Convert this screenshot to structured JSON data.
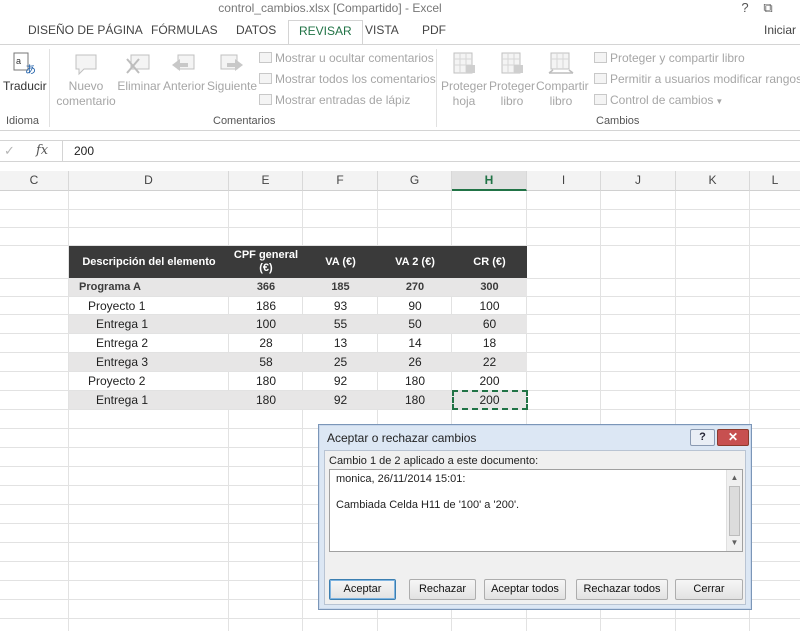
{
  "window": {
    "title": "control_cambios.xlsx  [Compartido] - Excel",
    "help_btn": "?",
    "restore_btn": "⧉"
  },
  "tabs": [
    {
      "label": "DISEÑO DE PÁGINA"
    },
    {
      "label": "FÓRMULAS"
    },
    {
      "label": "DATOS"
    },
    {
      "label": "REVISAR"
    },
    {
      "label": "VISTA"
    },
    {
      "label": "PDF"
    }
  ],
  "signin": "Iniciar",
  "ribbon": {
    "idioma": {
      "translate": "Traducir",
      "group": "Idioma"
    },
    "comentarios": {
      "new_line1": "Nuevo",
      "new_line2": "comentario",
      "delete": "Eliminar",
      "previous": "Anterior",
      "next": "Siguiente",
      "show_hide": "Mostrar u ocultar comentarios",
      "show_all": "Mostrar todos los comentarios",
      "show_ink": "Mostrar entradas de lápiz",
      "group": "Comentarios"
    },
    "cambios": {
      "protect_sheet_1": "Proteger",
      "protect_sheet_2": "hoja",
      "protect_book_1": "Proteger",
      "protect_book_2": "libro",
      "share_book_1": "Compartir",
      "share_book_2": "libro",
      "protect_share": "Proteger y compartir libro",
      "allow_ranges": "Permitir a usuarios modificar rangos",
      "track_changes": "Control de cambios",
      "group": "Cambios"
    }
  },
  "formula_bar": {
    "cancel": "✓",
    "fx": "fx",
    "value": "200"
  },
  "columns": [
    "C",
    "D",
    "E",
    "F",
    "G",
    "H",
    "I",
    "J",
    "K",
    "L"
  ],
  "table": {
    "headers": [
      "Descripción del elemento",
      "CPF general (€)",
      "VA (€)",
      "VA 2 (€)",
      "CR (€)"
    ],
    "rows": [
      {
        "desc": "Programa A",
        "v1": "366",
        "v2": "185",
        "v3": "270",
        "v4": "300"
      },
      {
        "desc": "Proyecto 1",
        "v1": "186",
        "v2": "93",
        "v3": "90",
        "v4": "100"
      },
      {
        "desc": "Entrega 1",
        "v1": "100",
        "v2": "55",
        "v3": "50",
        "v4": "60"
      },
      {
        "desc": "Entrega 2",
        "v1": "28",
        "v2": "13",
        "v3": "14",
        "v4": "18"
      },
      {
        "desc": "Entrega 3",
        "v1": "58",
        "v2": "25",
        "v3": "26",
        "v4": "22"
      },
      {
        "desc": "Proyecto 2",
        "v1": "180",
        "v2": "92",
        "v3": "180",
        "v4": "200"
      },
      {
        "desc": "Entrega 1",
        "v1": "180",
        "v2": "92",
        "v3": "180",
        "v4": "200"
      }
    ]
  },
  "dialog": {
    "title": "Aceptar o rechazar cambios",
    "help": "?",
    "close": "✕",
    "caption": "Cambio 1 de 2 aplicado a este documento:",
    "author": "monica, 26/11/2014 15:01:",
    "change_text": "Cambiada Celda H11 de '100' a '200'.",
    "buttons": {
      "accept": "Aceptar",
      "reject": "Rechazar",
      "accept_all": "Aceptar todos",
      "reject_all": "Rechazar todos",
      "close": "Cerrar"
    }
  }
}
